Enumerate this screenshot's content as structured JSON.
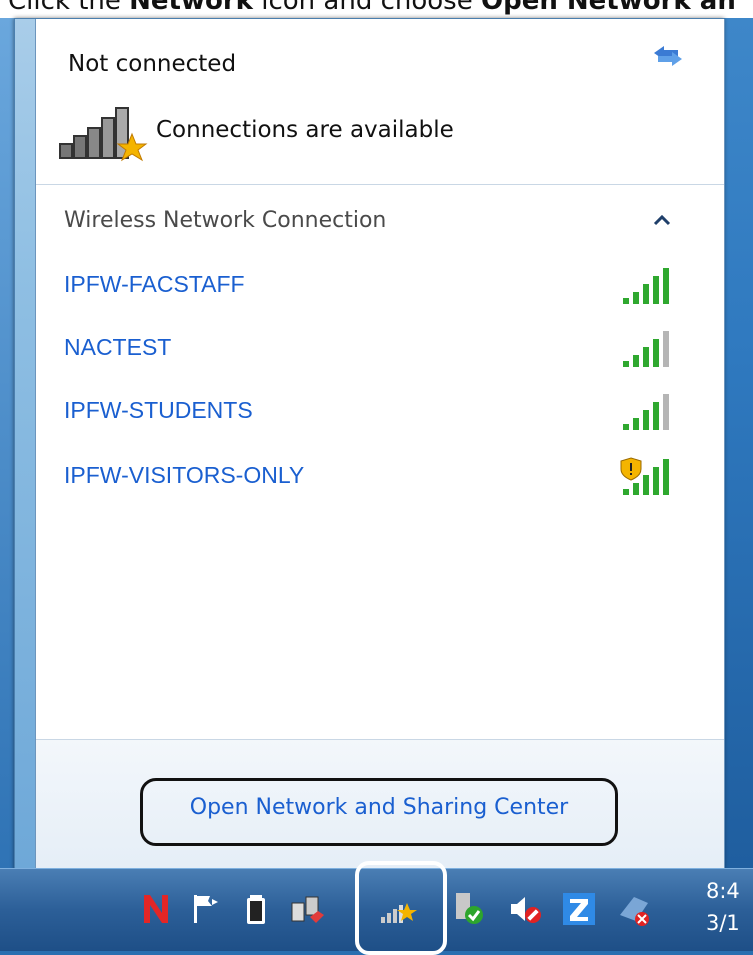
{
  "caption": {
    "pre": "Click the ",
    "bold1": "Network",
    "mid": " icon and choose ",
    "bold2": "Open Network an"
  },
  "status": {
    "title": "Not connected",
    "subtitle": "Connections are available"
  },
  "section": {
    "header": "Wireless Network Connection"
  },
  "networks": [
    {
      "name": "IPFW-FACSTAFF",
      "bars": 5,
      "secured": false
    },
    {
      "name": "NACTEST",
      "bars": 4,
      "secured": false
    },
    {
      "name": "IPFW-STUDENTS",
      "bars": 4,
      "secured": false
    },
    {
      "name": "IPFW-VISITORS-ONLY",
      "bars": 5,
      "secured": true
    }
  ],
  "footer": {
    "link": "Open Network and Sharing Center"
  },
  "taskbar": {
    "icons": [
      "n-app-icon",
      "flag-icon",
      "battery-icon",
      "network-ethernet-icon",
      "wireless-network-icon",
      "ok-status-icon",
      "volume-muted-icon",
      "z-app-icon",
      "bluetooth-disabled-icon"
    ],
    "clock_time": "8:4",
    "clock_date": "3/1"
  },
  "colors": {
    "link": "#1a5fd0",
    "signal": "#2fa82f",
    "signal_dim": "#b5b5b5",
    "accent_star": "#f4b400"
  }
}
